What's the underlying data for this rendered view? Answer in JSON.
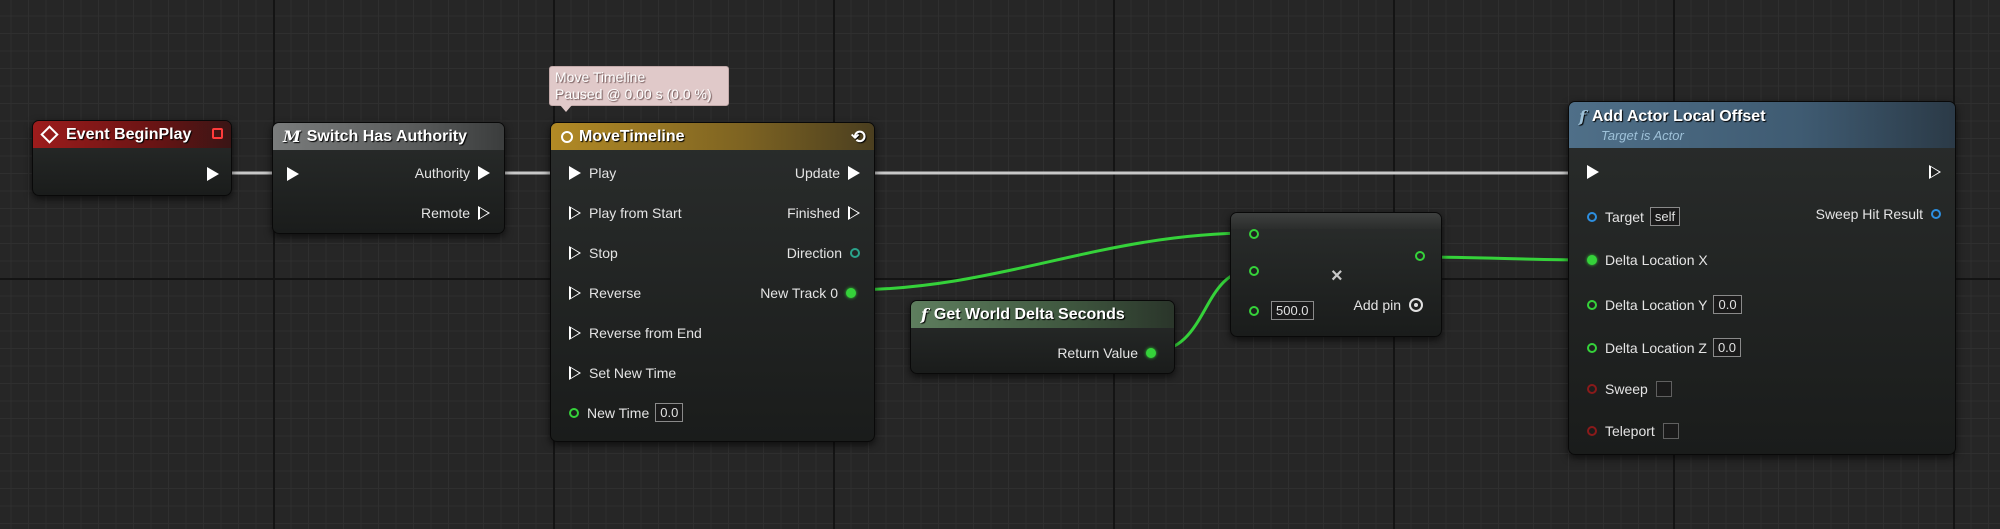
{
  "tooltip": {
    "line1": "Move Timeline",
    "line2": "Paused @ 0.00 s (0.0 %)"
  },
  "begin_play": {
    "title": "Event BeginPlay"
  },
  "switch_auth": {
    "title": "Switch Has Authority",
    "icon": "M",
    "authority": "Authority",
    "remote": "Remote"
  },
  "timeline": {
    "title": "MoveTimeline",
    "inputs": [
      "Play",
      "Play from Start",
      "Stop",
      "Reverse",
      "Reverse from End",
      "Set New Time"
    ],
    "new_time_label": "New Time",
    "new_time_value": "0.0",
    "outputs": [
      "Update",
      "Finished",
      "Direction",
      "New Track 0"
    ]
  },
  "delta_seconds": {
    "title": "Get World Delta Seconds",
    "icon": "f",
    "return_value": "Return Value"
  },
  "multiply": {
    "operand_value": "500.0",
    "add_pin": "Add pin",
    "operator": "×"
  },
  "add_offset": {
    "title": "Add Actor Local Offset",
    "subtitle": "Target is Actor",
    "icon": "f",
    "target_label": "Target",
    "target_value": "self",
    "sweep_hit_result": "Sweep Hit Result",
    "delta_x": "Delta Location X",
    "delta_y": "Delta Location Y",
    "delta_y_value": "0.0",
    "delta_z": "Delta Location Z",
    "delta_z_value": "0.0",
    "sweep": "Sweep",
    "teleport": "Teleport"
  },
  "colors": {
    "exec_wire": "#c8c8c8",
    "float_wire": "#35d23a",
    "event_header": "#9d1c1c",
    "timeline_header": "#b28a25",
    "function_header": "#4f6f88"
  }
}
